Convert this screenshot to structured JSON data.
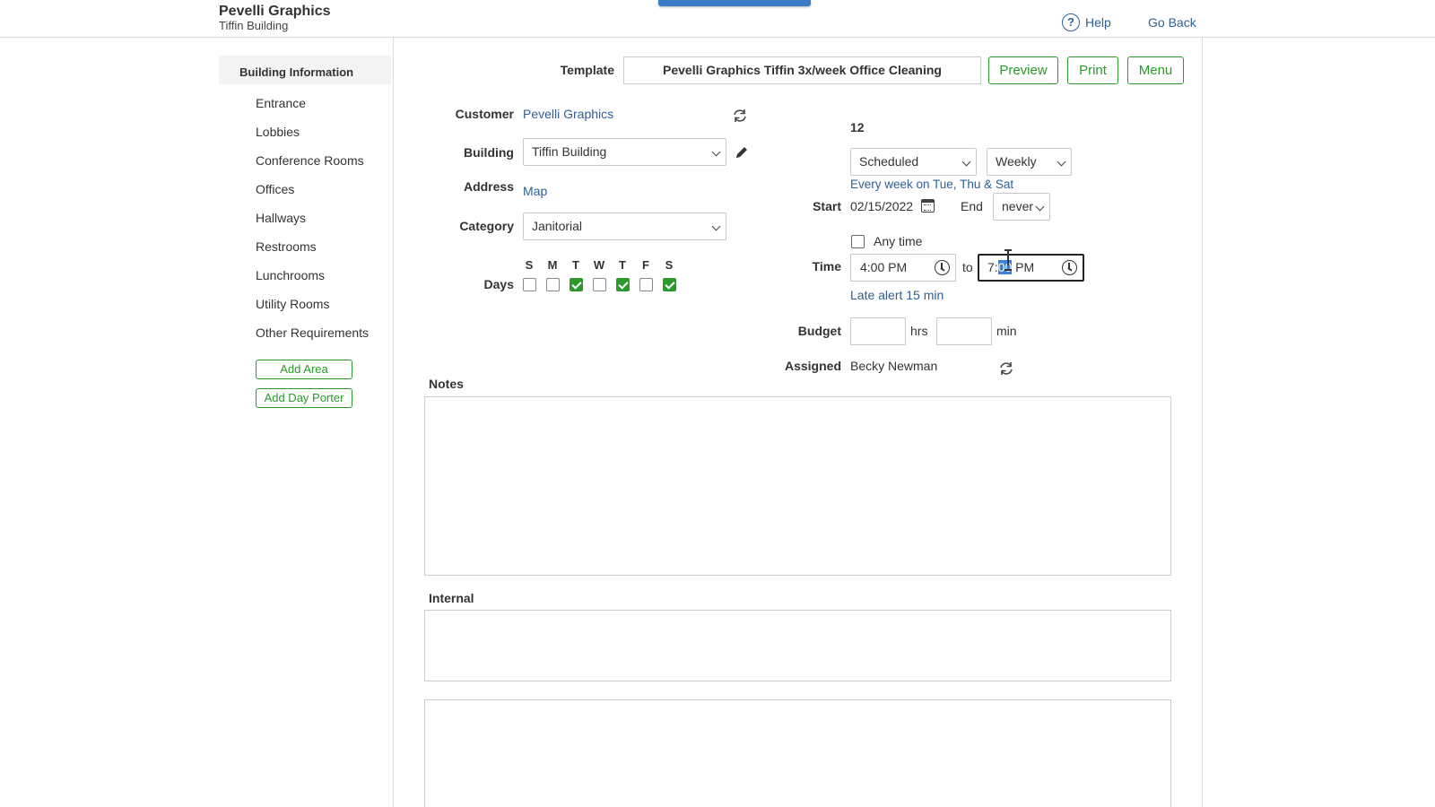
{
  "header": {
    "company": "Pevelli Graphics",
    "building": "Tiffin Building",
    "help_label": "Help",
    "go_back_label": "Go Back"
  },
  "sidebar": {
    "heading": "Building Information",
    "items": [
      {
        "label": "Entrance"
      },
      {
        "label": "Lobbies"
      },
      {
        "label": "Conference Rooms"
      },
      {
        "label": "Offices"
      },
      {
        "label": "Hallways"
      },
      {
        "label": "Restrooms"
      },
      {
        "label": "Lunchrooms"
      },
      {
        "label": "Utility Rooms"
      },
      {
        "label": "Other Requirements"
      }
    ],
    "add_area_label": "Add Area",
    "add_day_porter_label": "Add Day Porter"
  },
  "toolbar": {
    "template_label": "Template",
    "template_value": "Pevelli Graphics Tiffin 3x/week Office Cleaning",
    "preview_label": "Preview",
    "print_label": "Print",
    "menu_label": "Menu"
  },
  "form": {
    "customer_label": "Customer",
    "customer_value": "Pevelli Graphics",
    "building_label": "Building",
    "building_value": "Tiffin Building",
    "address_label": "Address",
    "address_value": "Map",
    "category_label": "Category",
    "category_value": "Janitorial",
    "days_label": "Days",
    "days": [
      {
        "letter": "S",
        "checked": false
      },
      {
        "letter": "M",
        "checked": false
      },
      {
        "letter": "T",
        "checked": true
      },
      {
        "letter": "W",
        "checked": false
      },
      {
        "letter": "T",
        "checked": true
      },
      {
        "letter": "F",
        "checked": false
      },
      {
        "letter": "S",
        "checked": true
      }
    ]
  },
  "schedule": {
    "number": "12",
    "status_value": "Scheduled",
    "frequency_value": "Weekly",
    "recurrence_text": "Every week on Tue, Thu & Sat",
    "start_label": "Start",
    "start_value": "02/15/2022",
    "end_label": "End",
    "end_value": "never",
    "any_time_label": "Any time",
    "time_label": "Time",
    "time_from": "4:00 PM",
    "time_to_sep": "to",
    "time_to_prefix": "7:",
    "time_to_selected": "00",
    "time_to_suffix": " PM",
    "late_alert": "Late alert 15 min",
    "budget_label": "Budget",
    "budget_hrs_unit": "hrs",
    "budget_min_unit": "min",
    "assigned_label": "Assigned",
    "assigned_value": "Becky Newman"
  },
  "notes": {
    "notes_label": "Notes",
    "internal_label": "Internal"
  },
  "colors": {
    "accent_green": "#2b9a2b",
    "link_blue": "#2f5f93",
    "selection_blue": "#3b82d9"
  }
}
